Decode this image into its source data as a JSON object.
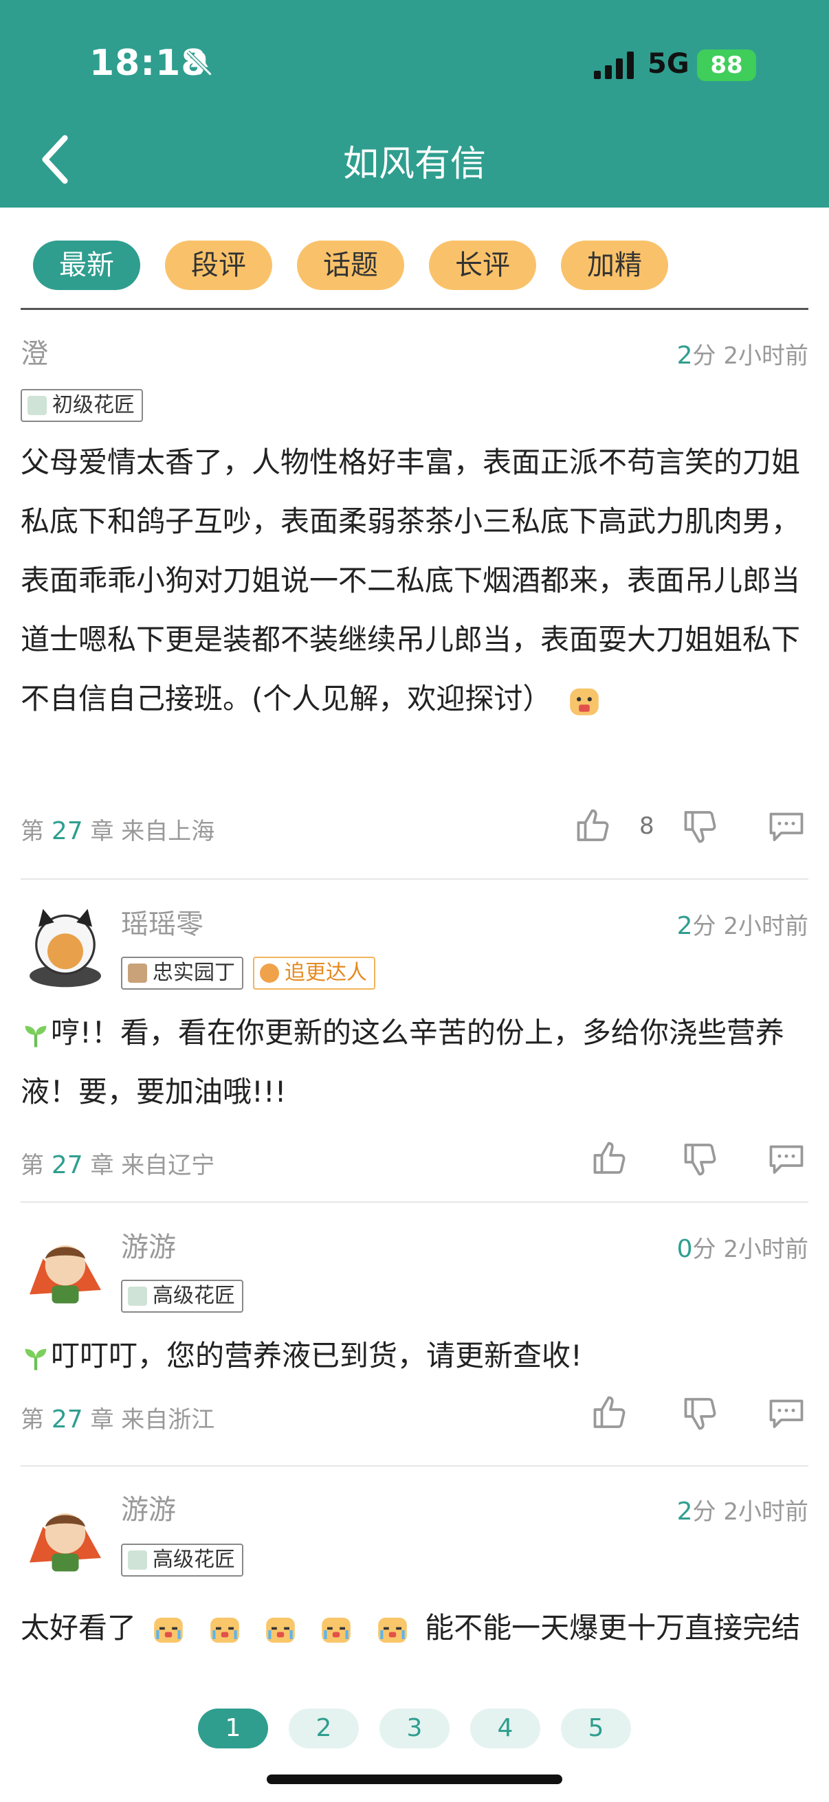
{
  "status_bar": {
    "time": "18:18",
    "network": "5G",
    "battery": "88"
  },
  "header": {
    "title": "如风有信"
  },
  "tabs": [
    {
      "label": "最新",
      "active": true
    },
    {
      "label": "段评",
      "active": false
    },
    {
      "label": "话题",
      "active": false
    },
    {
      "label": "长评",
      "active": false
    },
    {
      "label": "加精",
      "active": false
    }
  ],
  "comments": [
    {
      "name": "澄",
      "score": "2",
      "score_unit": "分",
      "time": "2小时前",
      "badges": [
        "初级花匠"
      ],
      "body": "父母爱情太香了，人物性格好丰富，表面正派不苟言笑的刀姐私底下和鸽子互吵，表面柔弱茶茶小三私底下高武力肌肉男，表面乖乖小狗对刀姐说一不二私底下烟酒都来，表面吊儿郎当道士嗯私下更是装都不装继续吊儿郎当，表面耍大刀姐姐私下不自信自己接班。(个人见解，欢迎探讨）",
      "chapter_prefix": "第",
      "chapter": "27",
      "chapter_suffix": "章 来自上海",
      "likes": "8"
    },
    {
      "name": "瑶瑶零",
      "score": "2",
      "score_unit": "分",
      "time": "2小时前",
      "badges": [
        "忠实园丁",
        "追更达人"
      ],
      "body": "哼!！看，看在你更新的这么辛苦的份上，多给你浇些营养液！要，要加油哦!!!",
      "chapter_prefix": "第",
      "chapter": "27",
      "chapter_suffix": "章 来自辽宁"
    },
    {
      "name": "游游",
      "score": "0",
      "score_unit": "分",
      "time": "2小时前",
      "badges": [
        "高级花匠"
      ],
      "body": "叮叮叮，您的营养液已到货，请更新查收!",
      "chapter_prefix": "第",
      "chapter": "27",
      "chapter_suffix": "章 来自浙江"
    },
    {
      "name": "游游",
      "score": "2",
      "score_unit": "分",
      "time": "2小时前",
      "badges": [
        "高级花匠"
      ],
      "body_a": "太好看了",
      "body_b": "能不能一天爆更十万直接完结"
    }
  ],
  "pagination": [
    "1",
    "2",
    "3",
    "4",
    "5"
  ],
  "colors": {
    "accent": "#2f9e8f",
    "tab": "#f9c26a",
    "battery": "#3fce5a"
  }
}
